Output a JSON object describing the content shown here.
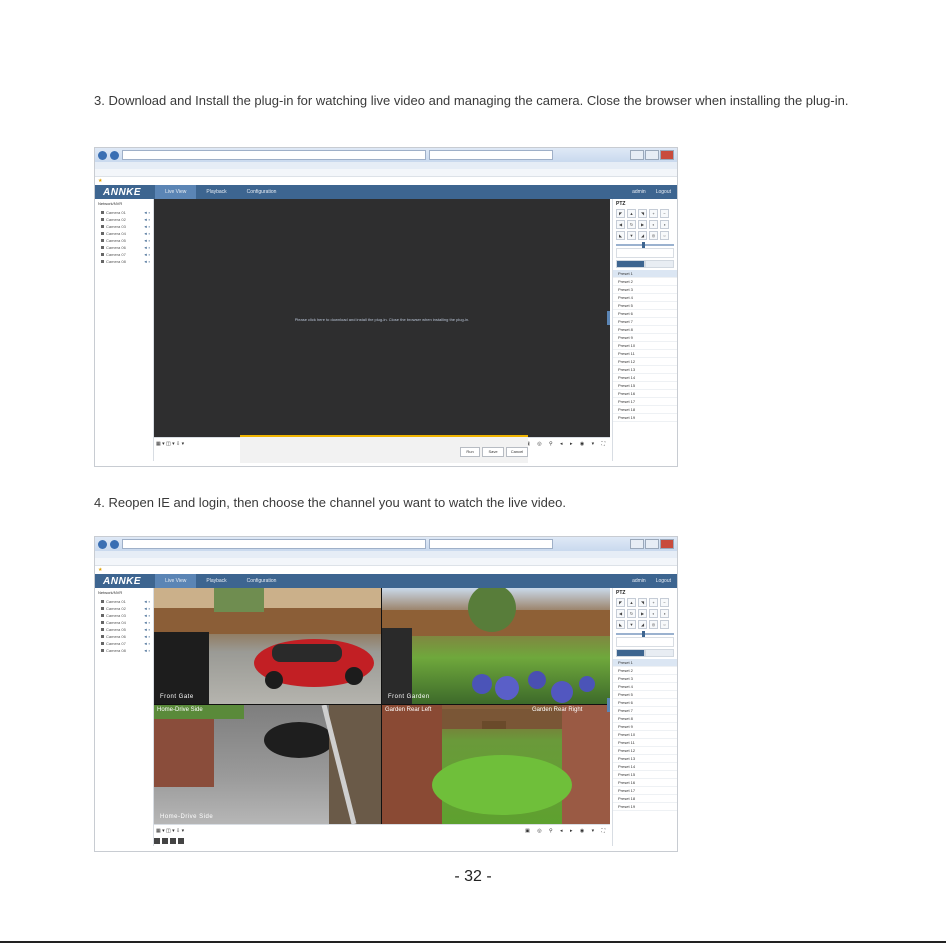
{
  "steps": {
    "step3": "3. Download and Install the plug-in for watching live video and managing the camera. Close the browser when installing the plug-in.",
    "step4": "4. Reopen IE and login, then choose the channel you want to watch the live video."
  },
  "page_number": "- 32 -",
  "app": {
    "logo": "ANNKE",
    "tabs": [
      "Live View",
      "Playback",
      "Configuration"
    ],
    "user_links": [
      "admin",
      "Logout"
    ],
    "device": "Network/NVR",
    "cameras": [
      "Camera 01",
      "Camera 02",
      "Camera 03",
      "Camera 04",
      "Camera 05",
      "Camera 06",
      "Camera 07",
      "Camera 08"
    ],
    "ptz_title": "PTZ",
    "presets": [
      "Preset 1",
      "Preset 2",
      "Preset 3",
      "Preset 4",
      "Preset 5",
      "Preset 6",
      "Preset 7",
      "Preset 8",
      "Preset 9",
      "Preset 10",
      "Preset 11",
      "Preset 12",
      "Preset 13",
      "Preset 14",
      "Preset 15",
      "Preset 16",
      "Preset 17",
      "Preset 18",
      "Preset 19",
      "Preset 20",
      "Preset 21"
    ]
  },
  "screenshot1": {
    "plugin_message": "Please click here to download and install the plug-in. Close the browser when installing the plug-in.",
    "download_buttons": [
      "Run",
      "Save",
      "Cancel"
    ]
  },
  "screenshot2": {
    "tile_labels": [
      "Front Gate",
      "Front Garden",
      "Home-Drive Side",
      "Garden Rear Left",
      "Garden Rear Right",
      "Home-Drive Side"
    ]
  },
  "colors": {
    "app_bar": "#3d6590",
    "video_bg": "#2e2e2f",
    "download_bar_accent": "#f0b400"
  }
}
